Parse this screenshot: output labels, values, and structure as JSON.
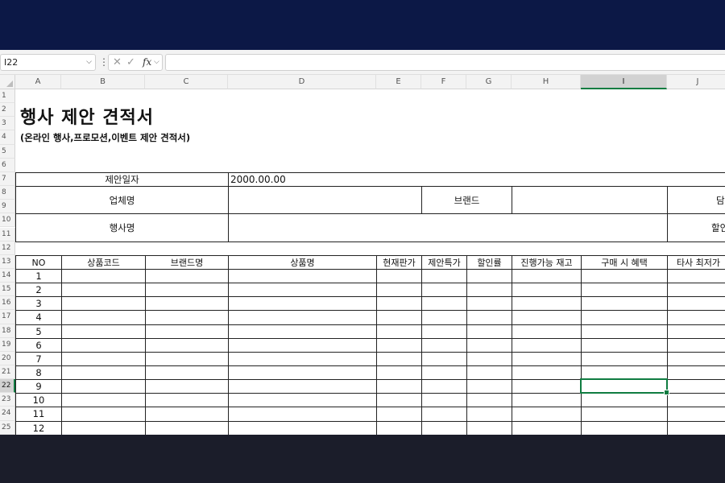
{
  "formula_bar": {
    "name_box": "I22",
    "fx_label": "fx",
    "formula_value": ""
  },
  "icons": {
    "dropdown": "chevron-down-icon",
    "cancel": "close-icon",
    "enter": "check-icon",
    "function": "fx-icon"
  },
  "colors": {
    "accent": "#107c41",
    "top_band": "#0c1846",
    "bottom_band": "#1b1d2a"
  },
  "columns": [
    "A",
    "B",
    "C",
    "D",
    "E",
    "F",
    "G",
    "H",
    "I",
    "J"
  ],
  "selected_column": "I",
  "rows": [
    "1",
    "2",
    "3",
    "4",
    "5",
    "6",
    "7",
    "8",
    "9",
    "10",
    "11",
    "12",
    "13",
    "14",
    "15",
    "16",
    "17",
    "18",
    "19",
    "20",
    "21",
    "22",
    "23",
    "24",
    "25"
  ],
  "selected_row": "22",
  "sheet": {
    "title": "행사 제안 견적서",
    "subtitle": "(온라인 행사,프로모션,이벤트 제안 견적서)",
    "proposal_date_label": "제안일자",
    "proposal_date_value": "2000.00.00",
    "company_label": "업체명",
    "brand_label": "브랜드",
    "contact_label": "담당",
    "event_label": "행사명",
    "discount_label": "할인",
    "table_headers": [
      "NO",
      "상품코드",
      "브랜드명",
      "상품명",
      "현재판가",
      "제안특가",
      "할인률",
      "진행가능 재고",
      "구매 시 혜택",
      "타사 최저가"
    ],
    "row_numbers": [
      "1",
      "2",
      "3",
      "4",
      "5",
      "6",
      "7",
      "8",
      "9",
      "10",
      "11",
      "12"
    ]
  }
}
